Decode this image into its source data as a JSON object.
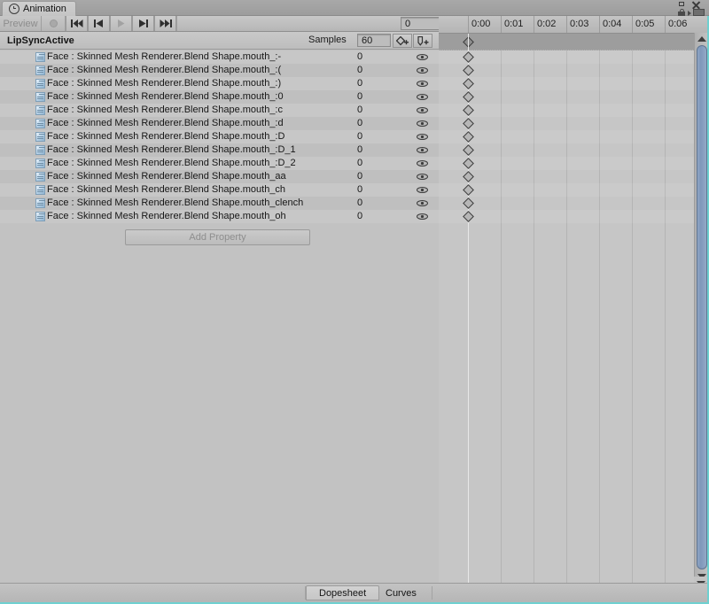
{
  "window": {
    "tab_label": "Animation",
    "tab_icon": "clock-icon",
    "controls": {
      "maximize": "maximize-icon",
      "close": "close-icon",
      "lock": "lock-icon",
      "menu": "menu-icon"
    }
  },
  "toolbar": {
    "preview_label": "Preview",
    "record_label": "record-button",
    "first_frame_label": "first-frame",
    "prev_frame_label": "previous-frame",
    "play_label": "play",
    "next_frame_label": "next-frame",
    "last_frame_label": "last-frame",
    "frame_value": "0"
  },
  "clipbar": {
    "clip_name": "LipSyncActive",
    "samples_label": "Samples",
    "samples_value": "60",
    "add_keyframe_label": "add-keyframe",
    "add_event_label": "add-event"
  },
  "properties": {
    "add_property_label": "Add Property",
    "rows": [
      {
        "name": "Face : Skinned Mesh Renderer.Blend Shape.mouth_:-",
        "value": "0"
      },
      {
        "name": "Face : Skinned Mesh Renderer.Blend Shape.mouth_:(",
        "value": "0"
      },
      {
        "name": "Face : Skinned Mesh Renderer.Blend Shape.mouth_:)",
        "value": "0"
      },
      {
        "name": "Face : Skinned Mesh Renderer.Blend Shape.mouth_:0",
        "value": "0"
      },
      {
        "name": "Face : Skinned Mesh Renderer.Blend Shape.mouth_:c",
        "value": "0"
      },
      {
        "name": "Face : Skinned Mesh Renderer.Blend Shape.mouth_:d",
        "value": "0"
      },
      {
        "name": "Face : Skinned Mesh Renderer.Blend Shape.mouth_:D",
        "value": "0"
      },
      {
        "name": "Face : Skinned Mesh Renderer.Blend Shape.mouth_:D_1",
        "value": "0"
      },
      {
        "name": "Face : Skinned Mesh Renderer.Blend Shape.mouth_:D_2",
        "value": "0"
      },
      {
        "name": "Face : Skinned Mesh Renderer.Blend Shape.mouth_aa",
        "value": "0"
      },
      {
        "name": "Face : Skinned Mesh Renderer.Blend Shape.mouth_ch",
        "value": "0"
      },
      {
        "name": "Face : Skinned Mesh Renderer.Blend Shape.mouth_clench",
        "value": "0"
      },
      {
        "name": "Face : Skinned Mesh Renderer.Blend Shape.mouth_oh",
        "value": "0"
      }
    ]
  },
  "timeline": {
    "ticks": [
      "0:00",
      "0:01",
      "0:02",
      "0:03",
      "0:04",
      "0:05",
      "0:06"
    ],
    "playhead_time": "0:00",
    "keyframe_time": "0:00",
    "keyframe_row_count": 14
  },
  "bottom_tabs": {
    "dopesheet_label": "Dopesheet",
    "curves_label": "Curves",
    "active": "Dopesheet"
  },
  "colors": {
    "accent": "#6fd0d0",
    "panel_bg": "#c0c0c0",
    "row_alt": "#c7c7c7",
    "summary_row": "#9d9d9d",
    "scrollbar": "#8099bd"
  }
}
